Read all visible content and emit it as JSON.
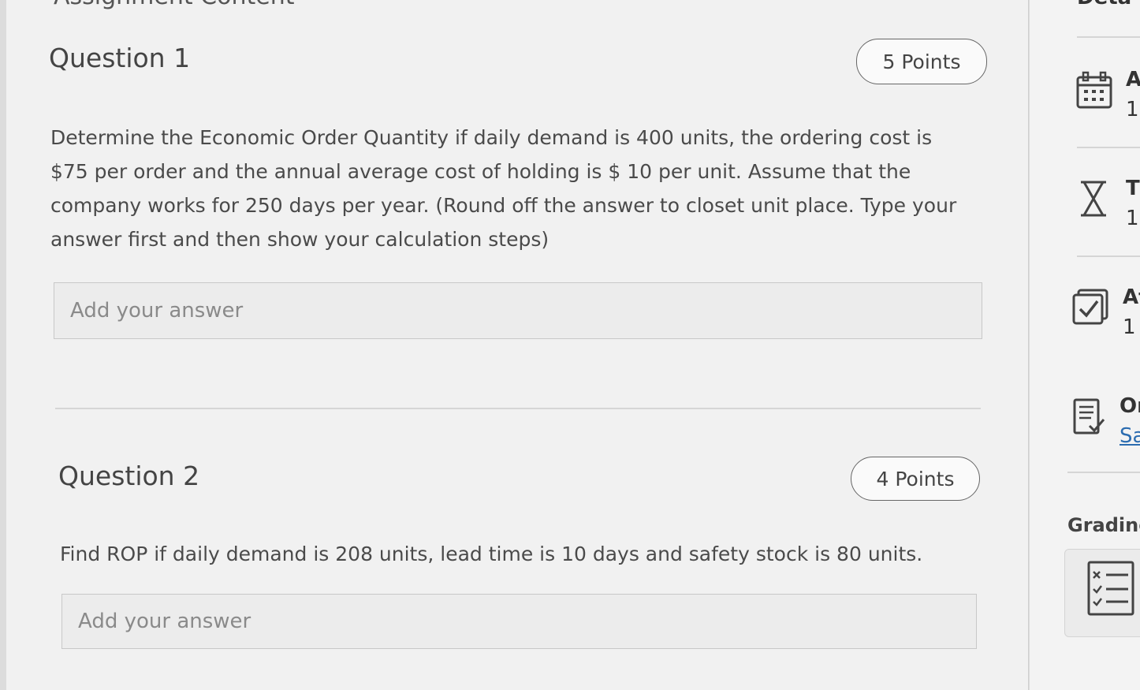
{
  "header": {
    "title": "Assignment Content"
  },
  "questions": [
    {
      "title": "Question 1",
      "points": "5 Points",
      "text": "Determine the Economic Order Quantity if daily demand is 400 units, the ordering cost is $75 per order and the annual average cost of holding is $ 10 per unit. Assume that the company works for 250 days per year. (Round off the answer to closet unit place. Type your answer first and then show your calculation steps)",
      "answer_placeholder": "Add your answer"
    },
    {
      "title": "Question 2",
      "points": "4 Points",
      "text": "Find ROP if daily demand is 208 units, lead time is 10 days and safety stock is 80 units.",
      "answer_placeholder": "Add your answer"
    }
  ],
  "details": {
    "title": "Deta",
    "items": [
      {
        "icon": "calendar-icon",
        "label": "A",
        "value": "1"
      },
      {
        "icon": "hourglass-icon",
        "label": "Ti",
        "value": "1"
      },
      {
        "icon": "checkbox-icon",
        "label": "At",
        "value": "1"
      },
      {
        "icon": "checklist-icon",
        "label": "Or",
        "value": "Sa"
      }
    ],
    "grading_label": "Grading"
  }
}
